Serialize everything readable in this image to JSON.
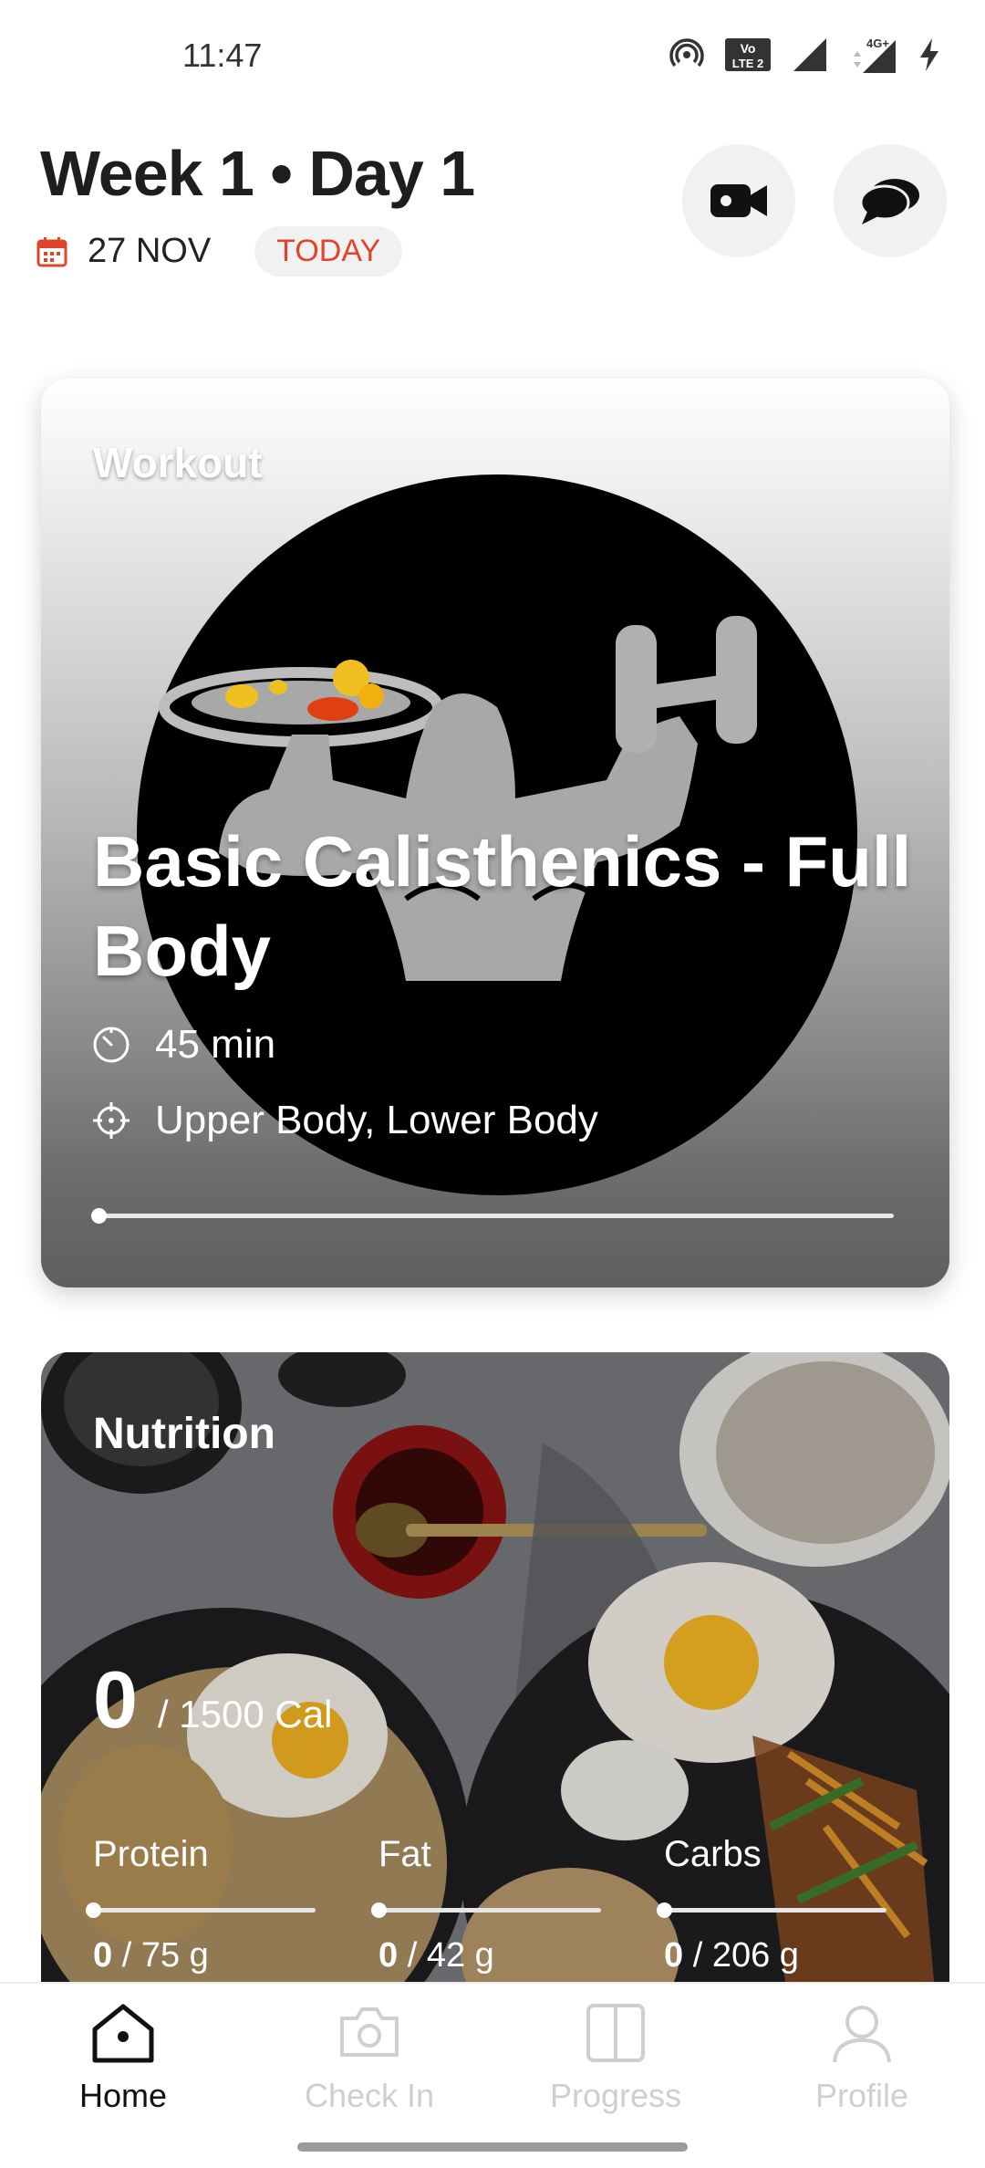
{
  "status_bar": {
    "time": "11:47",
    "lte_label": "LTE 2",
    "network_label": "4G+"
  },
  "header": {
    "title": "Week 1 • Day 1",
    "date": "27 NOV",
    "today_badge": "TODAY"
  },
  "workout_card": {
    "label": "Workout",
    "title": "Basic Calisthenics - Full Body",
    "duration": "45 min",
    "target_areas": "Upper Body, Lower Body",
    "progress": 0
  },
  "nutrition_card": {
    "label": "Nutrition",
    "calories_consumed": "0",
    "calories_target": "/ 1500 Cal",
    "macros": [
      {
        "name": "Protein",
        "consumed": "0",
        "target": " / 75 g",
        "progress": 0
      },
      {
        "name": "Fat",
        "consumed": "0",
        "target": " / 42 g",
        "progress": 0
      },
      {
        "name": "Carbs",
        "consumed": "0",
        "target": " / 206 g",
        "progress": 0
      }
    ]
  },
  "bottom_nav": {
    "items": [
      {
        "label": "Home",
        "icon": "home-icon",
        "active": true
      },
      {
        "label": "Check In",
        "icon": "camera-icon",
        "active": false
      },
      {
        "label": "Progress",
        "icon": "progress-icon",
        "active": false
      },
      {
        "label": "Profile",
        "icon": "profile-icon",
        "active": false
      }
    ]
  },
  "colors": {
    "accent": "#e0452c",
    "active_nav": "#111111",
    "inactive_nav": "#cfcfcf"
  }
}
